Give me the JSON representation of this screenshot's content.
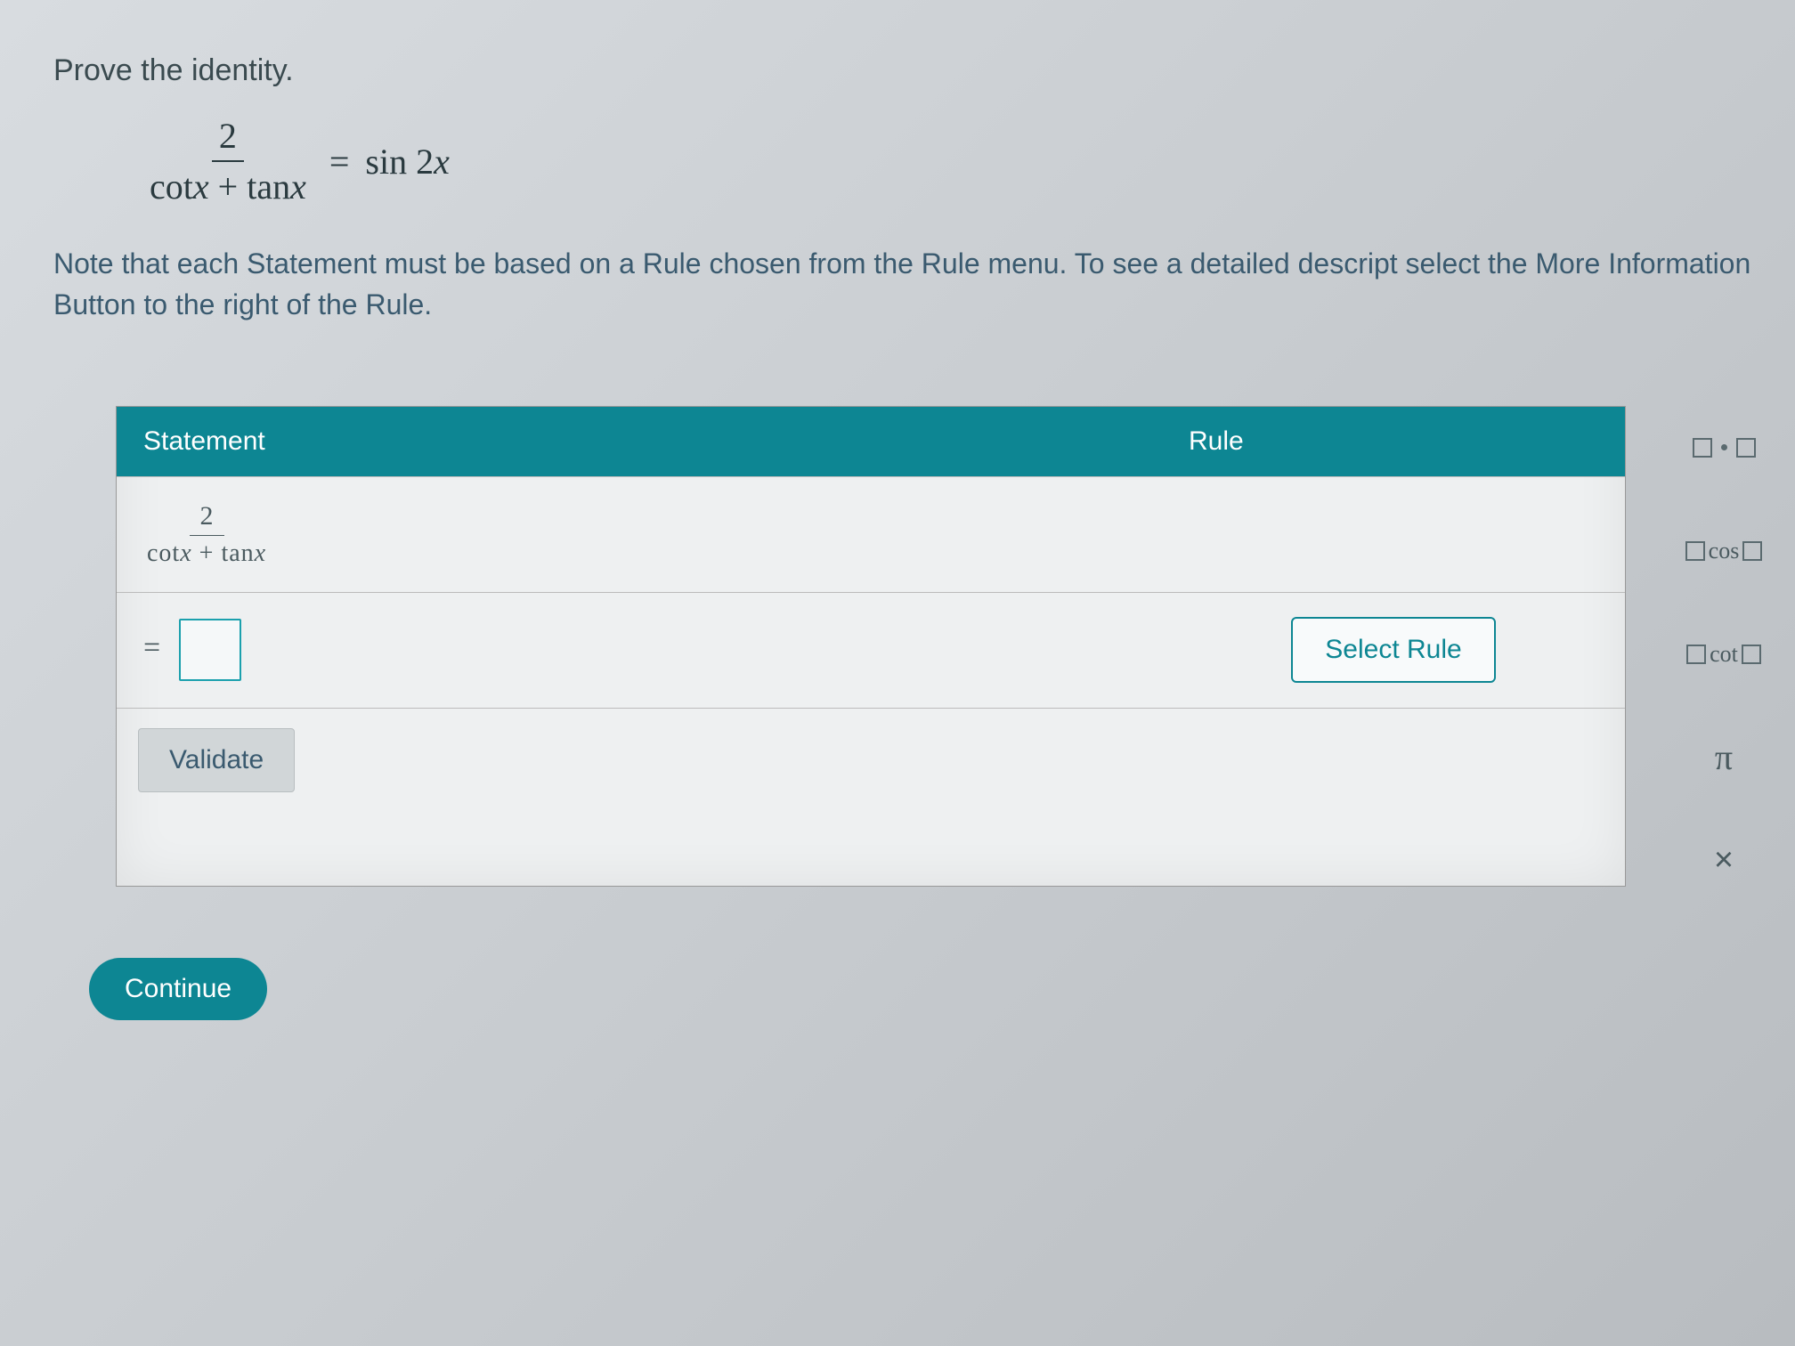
{
  "problem": {
    "title": "Prove the identity.",
    "formula": {
      "frac_num": "2",
      "frac_den_left": "cot",
      "frac_den_var1": "x",
      "frac_den_plus": "+ tan",
      "frac_den_var2": "x",
      "equals": "=",
      "rhs_fn": "sin 2",
      "rhs_var": "x"
    },
    "note": "Note that each Statement must be based on a Rule chosen from the Rule menu. To see a detailed descript select the More Information Button to the right of the Rule."
  },
  "table": {
    "header_statement": "Statement",
    "header_rule": "Rule",
    "row1": {
      "num": "2",
      "den_a": "cot",
      "den_v1": "x",
      "den_plus": " + ",
      "den_b": "tan",
      "den_v2": "x"
    },
    "row2": {
      "equals": "="
    },
    "select_rule_label": "Select Rule",
    "validate_label": "Validate"
  },
  "palette": {
    "cos": "cos",
    "cot": "cot",
    "pi": "π",
    "x": "×"
  },
  "continue_label": "Continue"
}
